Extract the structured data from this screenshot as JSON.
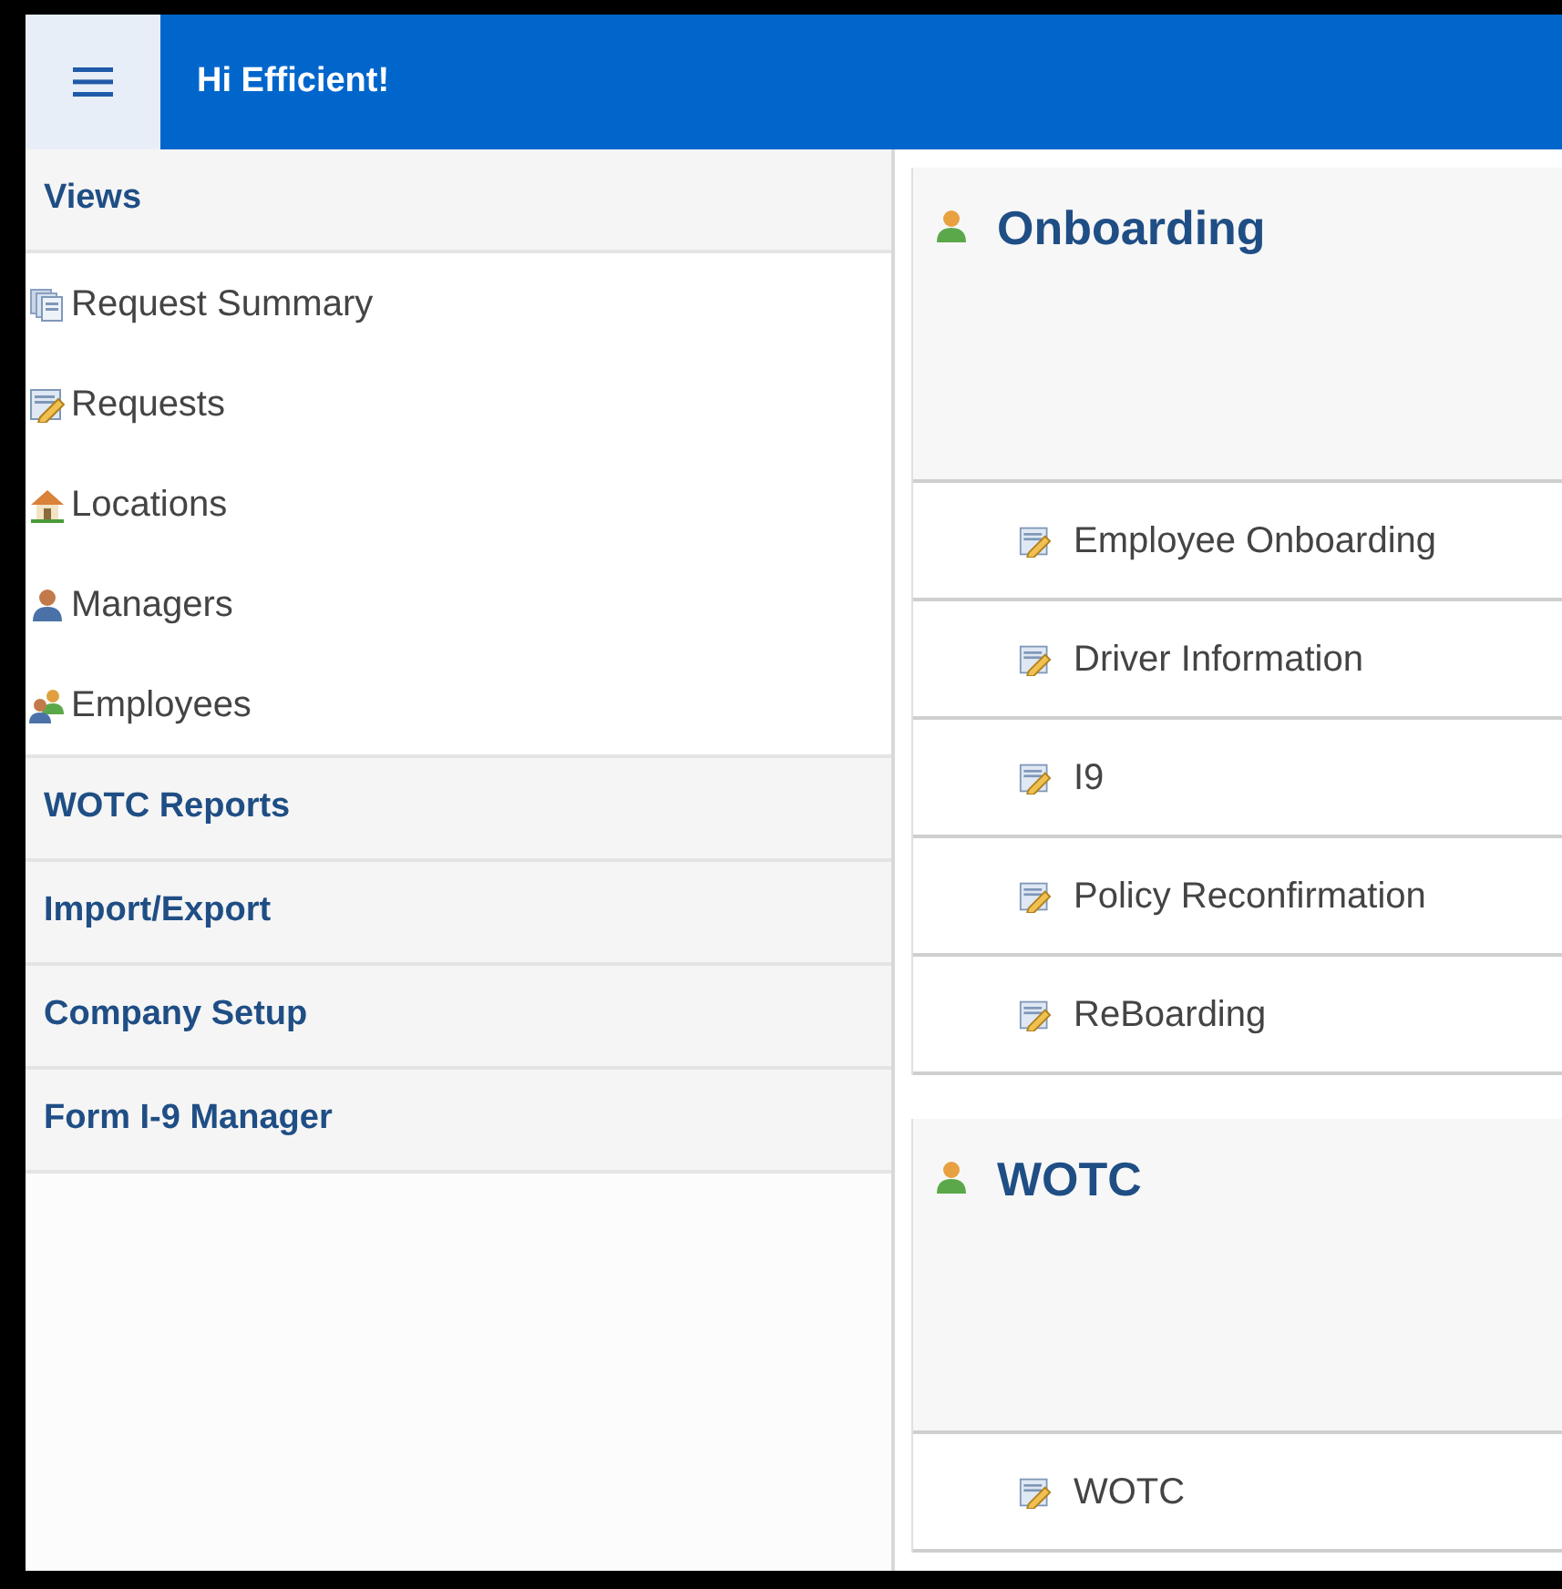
{
  "header": {
    "title": "Hi Efficient!"
  },
  "sidebar": {
    "sections": [
      {
        "title": "Views",
        "items": [
          "Request Summary",
          "Requests",
          "Locations",
          "Managers",
          "Employees"
        ]
      },
      {
        "title": "WOTC Reports"
      },
      {
        "title": "Import/Export"
      },
      {
        "title": "Company Setup"
      },
      {
        "title": "Form I-9 Manager"
      }
    ]
  },
  "groups": [
    {
      "title": "Onboarding",
      "items": [
        "Employee Onboarding",
        "Driver Information",
        "I9",
        "Policy Reconfirmation",
        "ReBoarding"
      ]
    },
    {
      "title": "WOTC",
      "items": [
        "WOTC"
      ]
    }
  ]
}
